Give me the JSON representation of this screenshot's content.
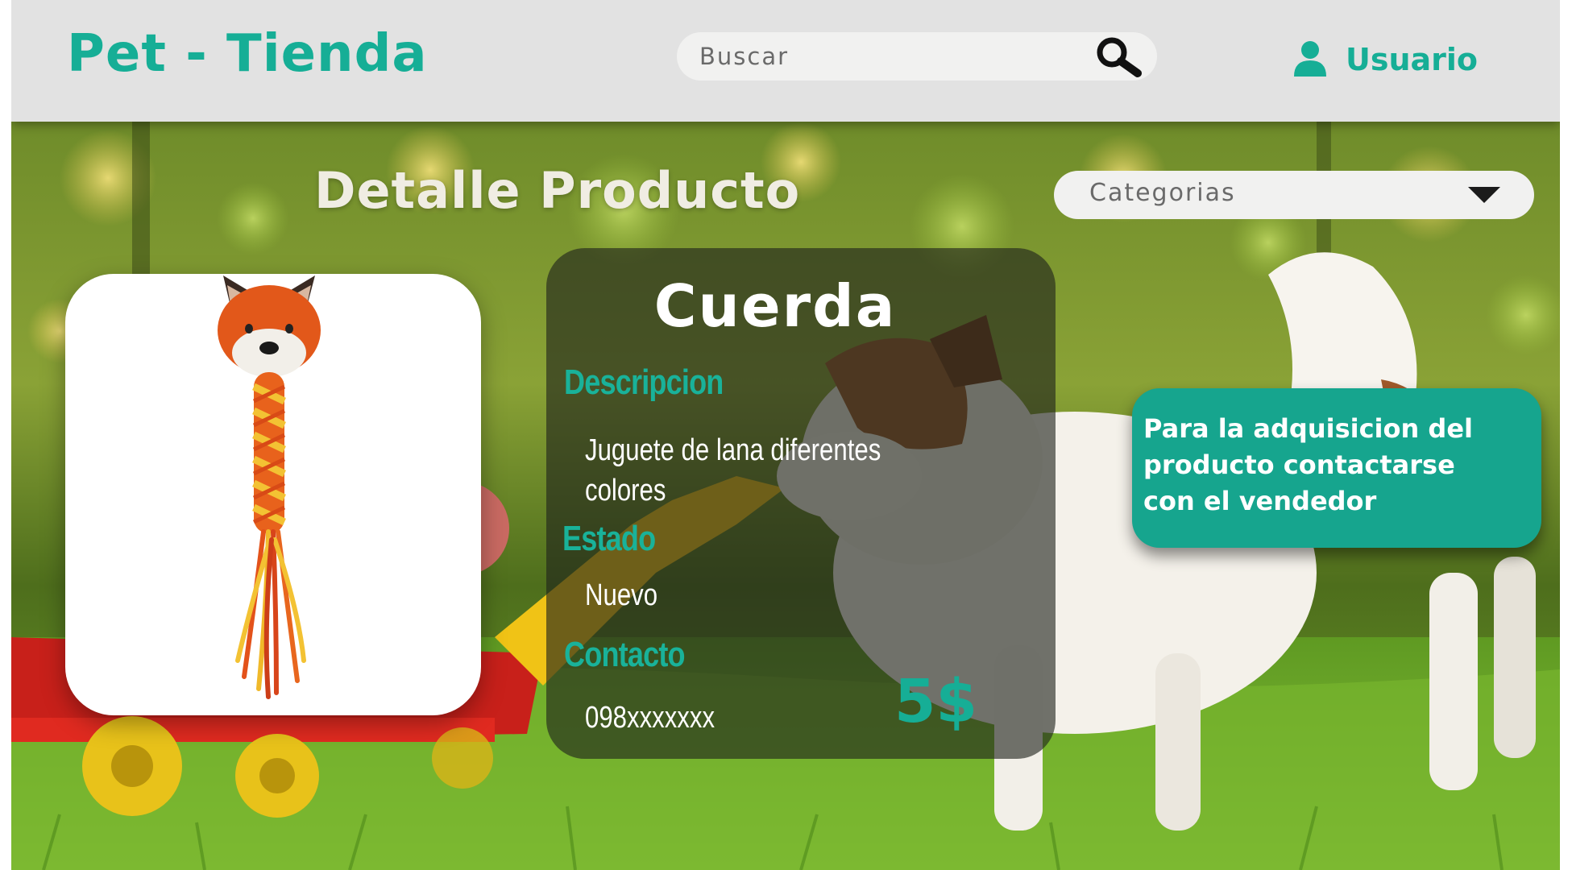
{
  "header": {
    "brand": "Pet - Tienda",
    "search": {
      "placeholder": "Buscar",
      "icon": "search-icon"
    },
    "user": {
      "label": "Usuario",
      "icon": "user-icon"
    }
  },
  "page": {
    "title": "Detalle Producto",
    "categories": {
      "label": "Categorias",
      "icon": "chevron-down-icon"
    }
  },
  "product": {
    "name": "Cuerda",
    "description_label": "Descripcion",
    "description": "Juguete de lana diferentes\n colores",
    "status_label": "Estado",
    "status": "Nuevo",
    "contact_label": "Contacto",
    "contact": "098xxxxxxx",
    "price": "5$"
  },
  "notice": {
    "text": "Para la adquisicion del\nproducto contactarse\n con el vendedor"
  },
  "colors": {
    "brand": "#16ae96",
    "header_bg": "#e2e2e2",
    "notice_bg": "#16a58e"
  }
}
